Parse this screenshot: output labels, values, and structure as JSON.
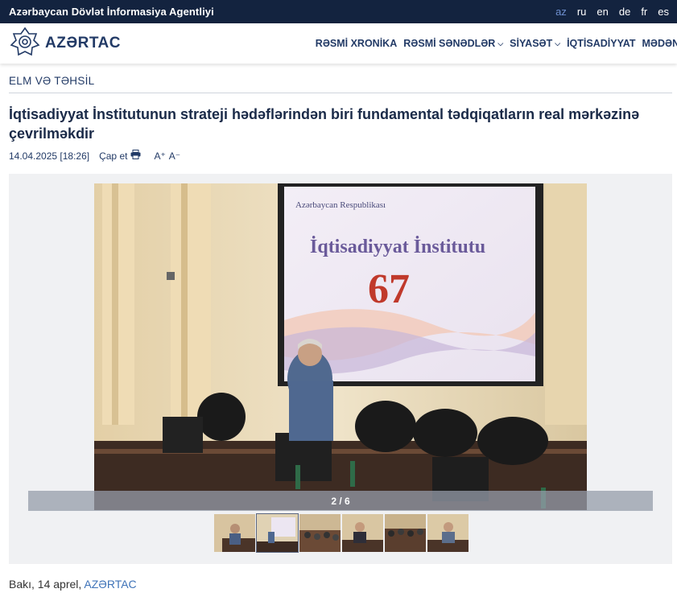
{
  "topbar": {
    "agency": "Azərbaycan Dövlət İnformasiya Agentliyi",
    "languages": [
      {
        "code": "az",
        "active": true
      },
      {
        "code": "ru",
        "active": false
      },
      {
        "code": "en",
        "active": false
      },
      {
        "code": "de",
        "active": false
      },
      {
        "code": "fr",
        "active": false
      },
      {
        "code": "es",
        "active": false
      }
    ]
  },
  "header": {
    "logo_text": "AZƏRTAC",
    "nav": [
      {
        "label": "RƏSMİ XRONİKA",
        "dropdown": false
      },
      {
        "label": "RƏSMİ SƏNƏDLƏR",
        "dropdown": true
      },
      {
        "label": "SİYASƏT",
        "dropdown": true
      },
      {
        "label": "İQTİSADİYYAT",
        "dropdown": false
      },
      {
        "label": "MƏDƏNİYYƏT",
        "dropdown": false
      }
    ]
  },
  "article": {
    "section": "ELM VƏ TƏHSİL",
    "title": "İqtisadiyyat İnstitutunun strateji hədəflərindən biri fundamental tədqiqatların real mərkəzinə çevrilməkdir",
    "date": "14.04.2025 [18:26]",
    "print_label": "Çap et",
    "font_increase": "A⁺",
    "font_decrease": "A⁻",
    "lead_prefix": "Bakı, 14 aprel, ",
    "lead_source": "AZƏRTAC"
  },
  "gallery": {
    "counter": "2 / 6",
    "current": 2,
    "total": 6,
    "slide": {
      "screen_header": "Azərbaycan Respublikası",
      "screen_title": "İqtisadiyyat İnstitutu",
      "screen_number": "67"
    }
  },
  "colors": {
    "topbar": "#13233f",
    "brand": "#223a66",
    "link": "#3f73b8",
    "active_lang": "#6e8fcf"
  }
}
